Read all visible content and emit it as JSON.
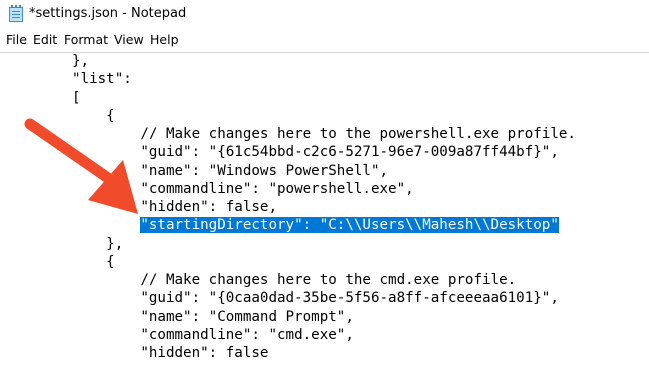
{
  "window": {
    "title": "*settings.json - Notepad"
  },
  "menu": [
    "File",
    "Edit",
    "Format",
    "View",
    "Help"
  ],
  "editor": {
    "lines": [
      {
        "text": "},",
        "indent": 8
      },
      {
        "text": "\"list\":",
        "indent": 8
      },
      {
        "text": "[",
        "indent": 8
      },
      {
        "text": "{",
        "indent": 12
      },
      {
        "text": "// Make changes here to the powershell.exe profile.",
        "indent": 16
      },
      {
        "text": "\"guid\": \"{61c54bbd-c2c6-5271-96e7-009a87ff44bf}\",",
        "indent": 16
      },
      {
        "text": "\"name\": \"Windows PowerShell\",",
        "indent": 16
      },
      {
        "text": "\"commandline\": \"powershell.exe\",",
        "indent": 16
      },
      {
        "text": "\"hidden\": false,",
        "indent": 16
      },
      {
        "text": "\"startingDirectory\": \"C:\\\\Users\\\\Mahesh\\\\Desktop\"",
        "indent": 16,
        "selected": true
      },
      {
        "text": "},",
        "indent": 12
      },
      {
        "text": "{",
        "indent": 12
      },
      {
        "text": "// Make changes here to the cmd.exe profile.",
        "indent": 16
      },
      {
        "text": "\"guid\": \"{0caa0dad-35be-5f56-a8ff-afceeeaa6101}\",",
        "indent": 16
      },
      {
        "text": "\"name\": \"Command Prompt\",",
        "indent": 16
      },
      {
        "text": "\"commandline\": \"cmd.exe\",",
        "indent": 16
      },
      {
        "text": "\"hidden\": false",
        "indent": 16
      }
    ]
  },
  "colors": {
    "selection": "#0078d7",
    "annotation_arrow": "#f14b2c"
  }
}
